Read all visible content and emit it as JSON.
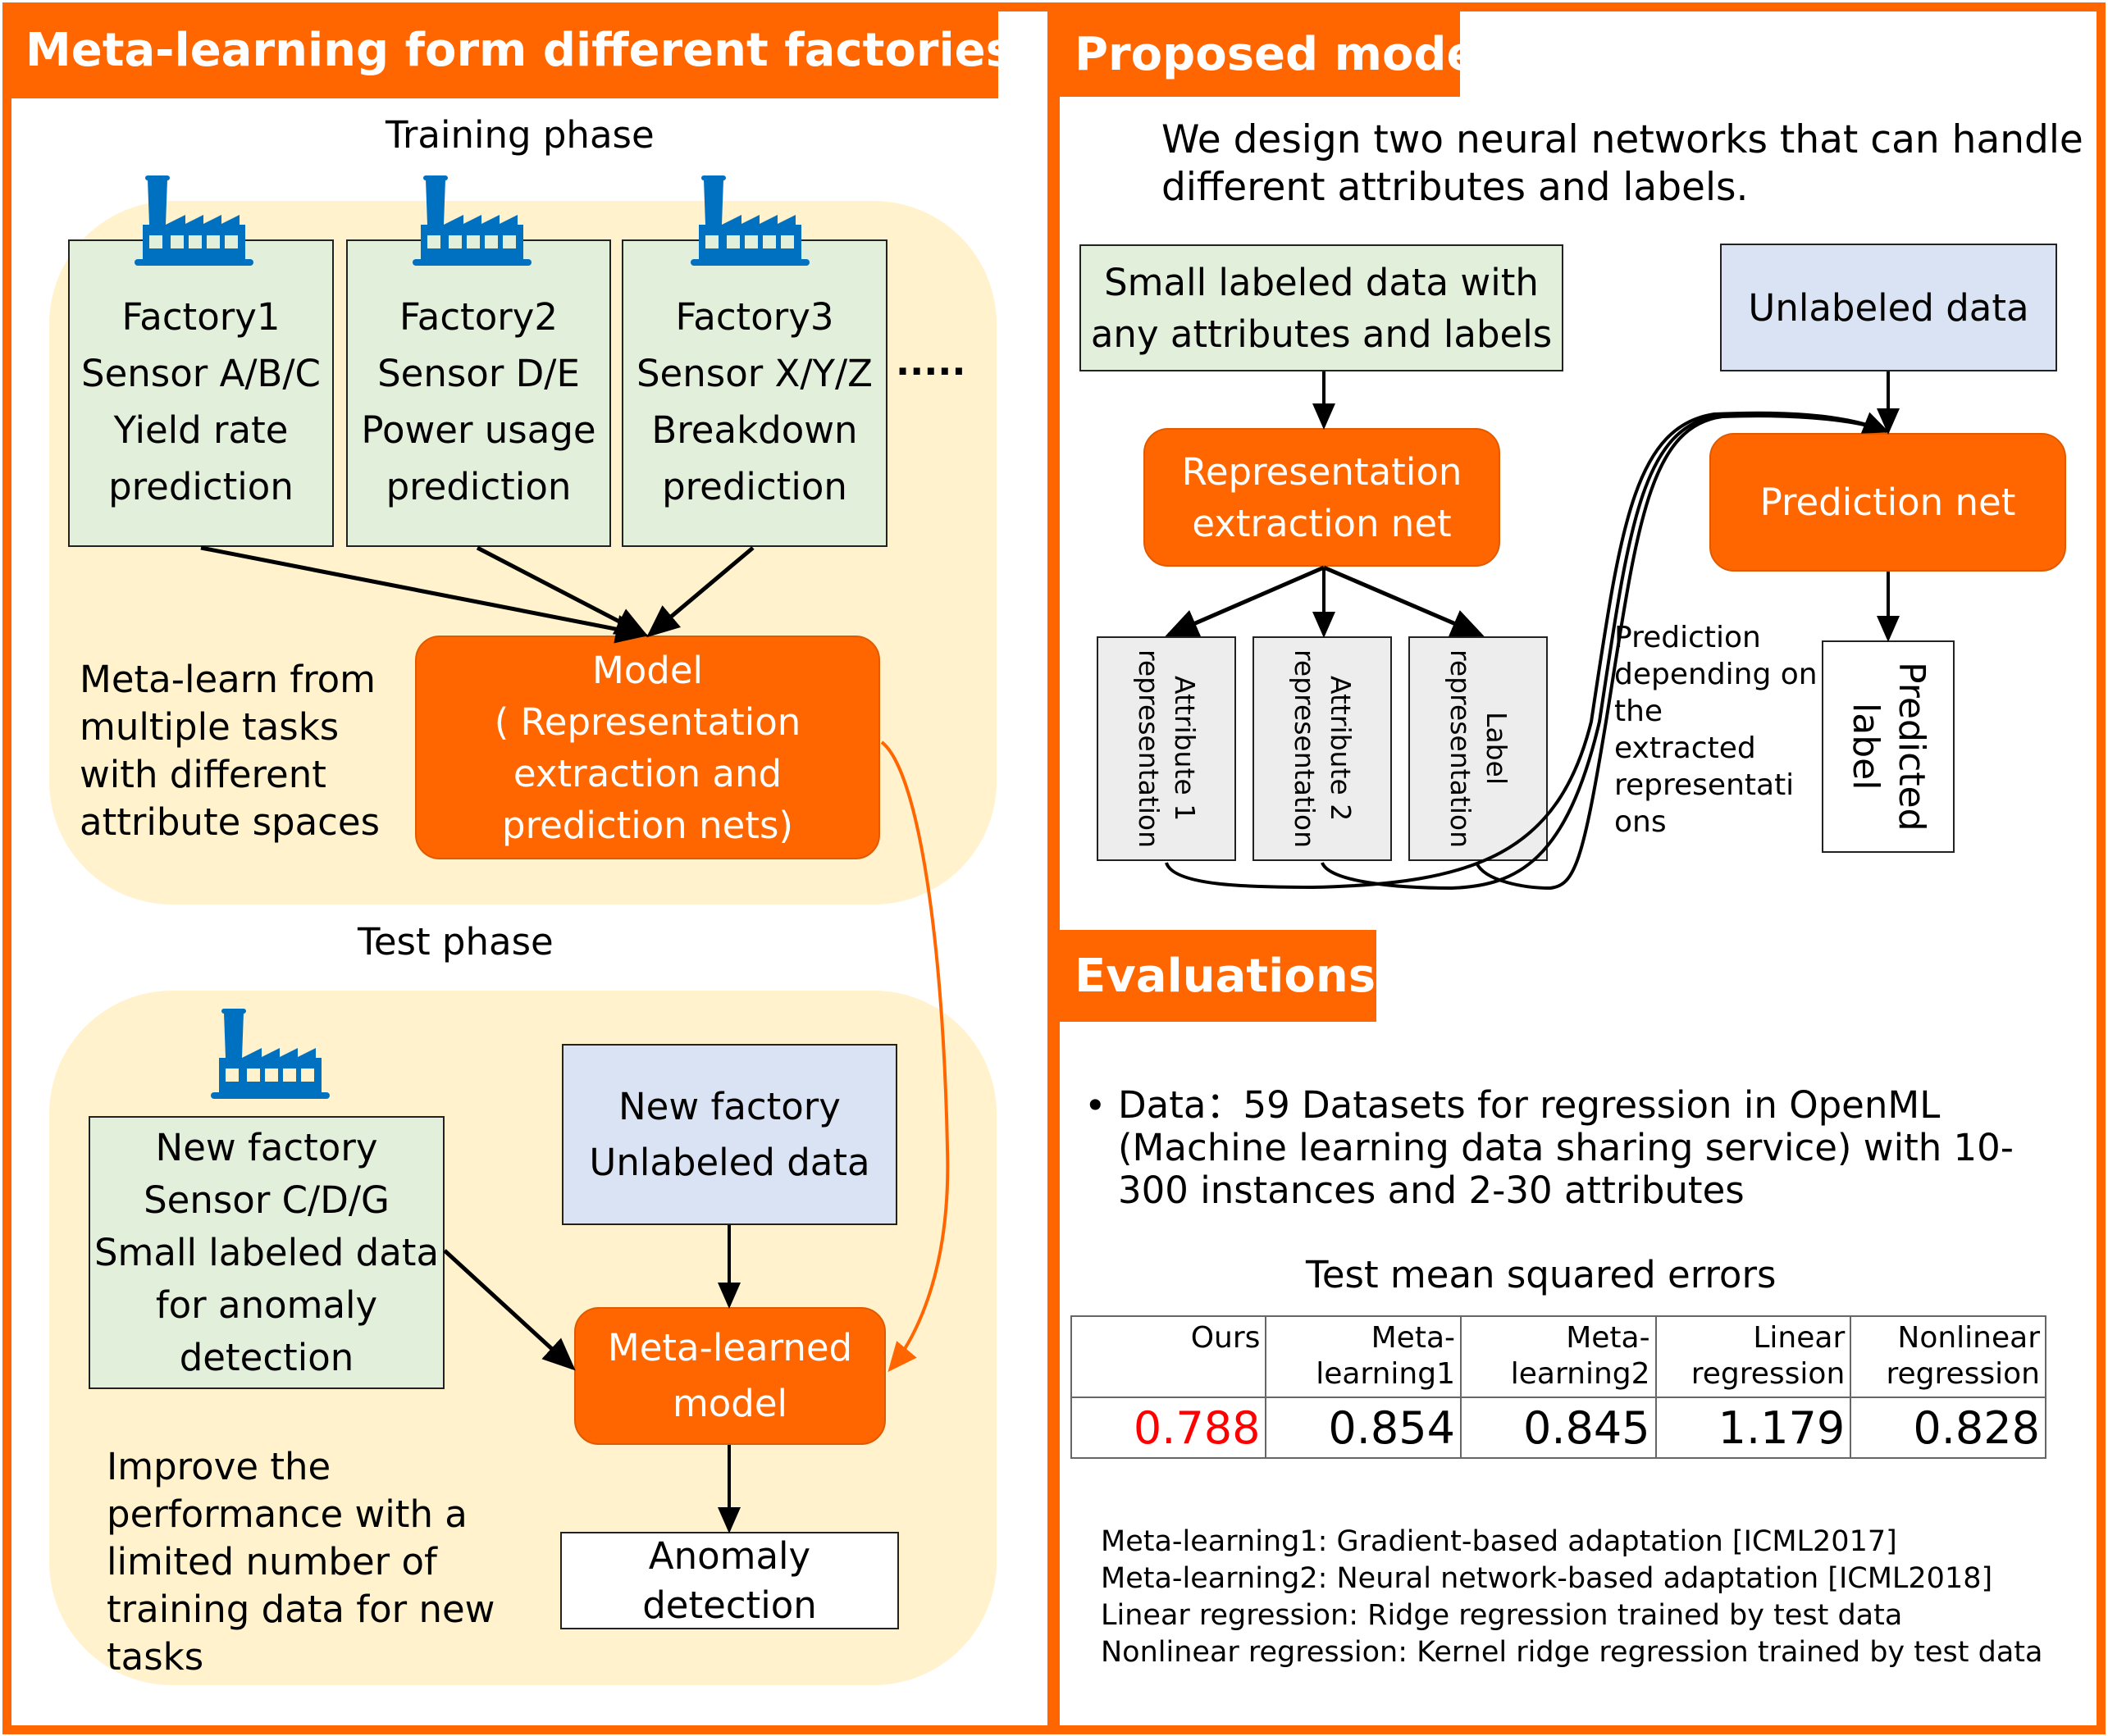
{
  "left_panel": {
    "title": "Meta-learning form different factories",
    "training": {
      "label": "Training phase",
      "factories": [
        {
          "text": "Factory1\nSensor A/B/C\nYield rate\nprediction",
          "icon": "factory-icon"
        },
        {
          "text": "Factory2\nSensor D/E\nPower usage\nprediction",
          "icon": "factory-icon"
        },
        {
          "text": "Factory3\nSensor X/Y/Z\nBreakdown\nprediction",
          "icon": "factory-icon"
        }
      ],
      "ellipsis": ".....",
      "description": "Meta-learn from\nmultiple tasks\nwith different\nattribute spaces",
      "model": "Model\n( Representation\nextraction and\nprediction nets)"
    },
    "test": {
      "label": "Test phase",
      "new_factory": {
        "text": "New factory\nSensor C/D/G\nSmall labeled data\nfor anomaly\ndetection",
        "icon": "factory-icon"
      },
      "unlabeled": "New factory\nUnlabeled data",
      "meta_model": "Meta-learned\nmodel",
      "output": "Anomaly\ndetection",
      "description": "Improve the\nperformance with a\nlimited number of\ntraining data for new\ntasks"
    }
  },
  "right_panel": {
    "title": "Proposed model",
    "intro": "We design two neural networks that can handle\ndifferent attributes and labels.",
    "labeled_input": "Small labeled data with\nany attributes and labels",
    "unlabeled_input": "Unlabeled data",
    "rep_net": "Representation\nextraction net",
    "pred_net": "Prediction net",
    "representations": [
      "Attribute 1\nrepresentation",
      "Attribute 2\nrepresentation",
      "Label\nrepresentation"
    ],
    "prediction_note": "Prediction\ndepending on\nthe\nextracted\nrepresentati\nons",
    "predicted_label": "Predicted\nlabel"
  },
  "evaluations": {
    "title": "Evaluations",
    "bullet": "Data：59 Datasets for regression in OpenML\n(Machine learning data sharing service) with 10-\n300 instances and 2-30 attributes",
    "table_title": "Test mean squared errors",
    "table": {
      "headers": [
        "Ours",
        "Meta-\nlearning1",
        "Meta-\nlearning2",
        "Linear\nregression",
        "Nonlinear\nregression"
      ],
      "values": [
        "0.788",
        "0.854",
        "0.845",
        "1.179",
        "0.828"
      ],
      "highlight_color": "#FF0000"
    },
    "notes": [
      "Meta-learning1: Gradient-based adaptation [ICML2017]",
      "Meta-learning2: Neural network-based adaptation [ICML2018]",
      "Linear regression: Ridge regression trained by test data",
      "Nonlinear regression: Kernel ridge regression trained by test data"
    ]
  },
  "colors": {
    "accent": "#FF6600",
    "phase_bg": "#FFF2CC",
    "green_box": "#E2EFDA",
    "blue_box": "#DAE3F3",
    "gray_box": "#EDEDED",
    "icon_blue": "#0070C0"
  }
}
